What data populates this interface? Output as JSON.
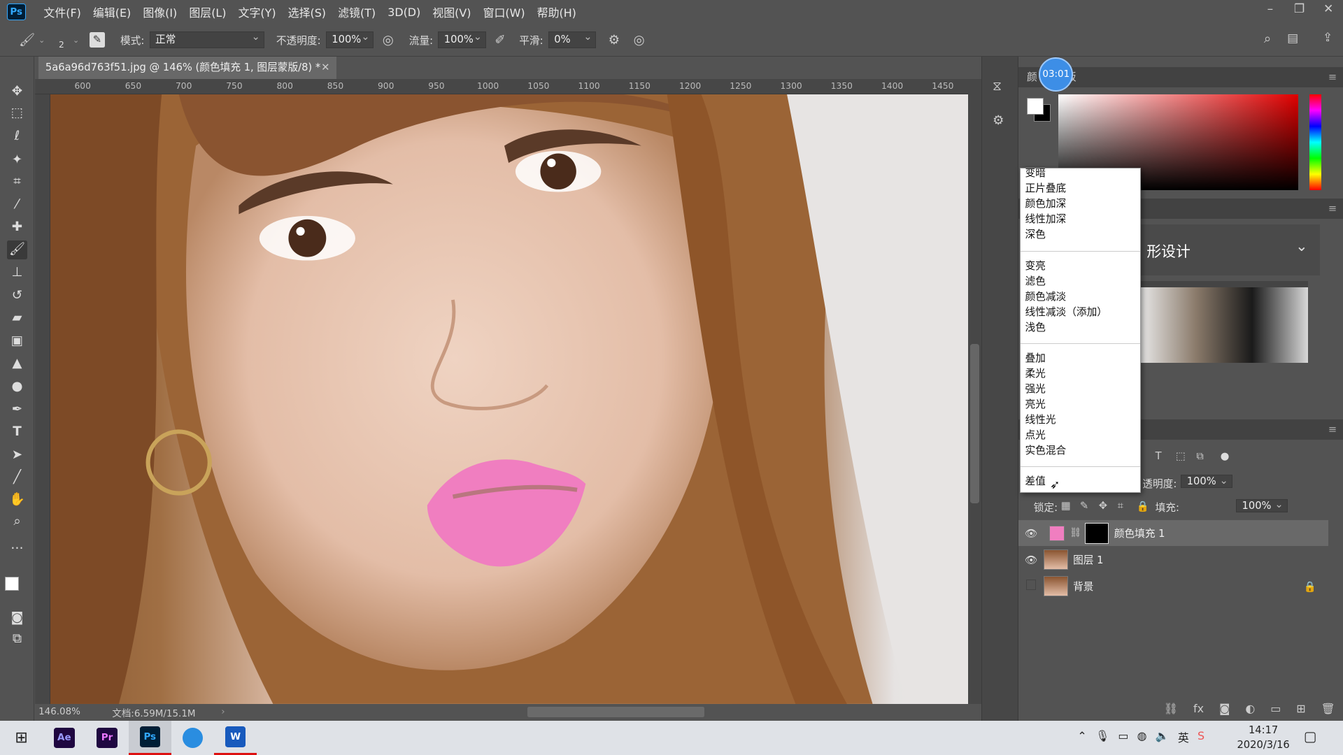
{
  "menubar": {
    "logo": "Ps",
    "items": [
      "文件(F)",
      "编辑(E)",
      "图像(I)",
      "图层(L)",
      "文字(Y)",
      "选择(S)",
      "滤镜(T)",
      "3D(D)",
      "视图(V)",
      "窗口(W)",
      "帮助(H)"
    ]
  },
  "options": {
    "brush_size": "2",
    "mode_label": "模式:",
    "mode_value": "正常",
    "opacity_label": "不透明度:",
    "opacity_value": "100%",
    "flow_label": "流量:",
    "flow_value": "100%",
    "smooth_label": "平滑:",
    "smooth_value": "0%"
  },
  "document": {
    "tab_title": "5a6a96d763f51.jpg @ 146% (颜色填充 1, 图层蒙版/8) *",
    "zoom": "146.08%",
    "doc_info": "文档:6.59M/15.1M"
  },
  "ruler": {
    "top_ticks": [
      "600",
      "650",
      "700",
      "750",
      "800",
      "850",
      "900",
      "950",
      "1000",
      "1050",
      "1100",
      "1150",
      "1200",
      "1250",
      "1300",
      "1350",
      "1400",
      "1450"
    ]
  },
  "timer": "03:01",
  "panels": {
    "color_tab": "颜",
    "swatch_tab": "板",
    "learn_title": "形设计",
    "opacity_label": "透明度:",
    "opacity_value": "100%",
    "lock_label": "锁定:",
    "fill_label": "填充:",
    "fill_value": "100%"
  },
  "blend_menu": {
    "groups": [
      [
        "变暗",
        "正片叠底",
        "颜色加深",
        "线性加深",
        "深色"
      ],
      [
        "变亮",
        "滤色",
        "颜色减淡",
        "线性减淡（添加）",
        "浅色"
      ],
      [
        "叠加",
        "柔光",
        "强光",
        "亮光",
        "线性光",
        "点光",
        "实色混合"
      ],
      [
        "差值"
      ]
    ]
  },
  "layers": [
    {
      "name": "颜色填充 1",
      "visible": true,
      "selected": true
    },
    {
      "name": "图层 1",
      "visible": true,
      "selected": false
    },
    {
      "name": "背景",
      "visible": false,
      "selected": false,
      "locked": true
    }
  ],
  "taskbar": {
    "apps": [
      "Ae",
      "Pr",
      "Ps",
      "browser",
      "W"
    ],
    "time": "14:17",
    "date": "2020/3/16",
    "ime": "英"
  },
  "colors": {
    "lip_fill": "#f07ec0",
    "ps_blue": "#31a8ff"
  }
}
